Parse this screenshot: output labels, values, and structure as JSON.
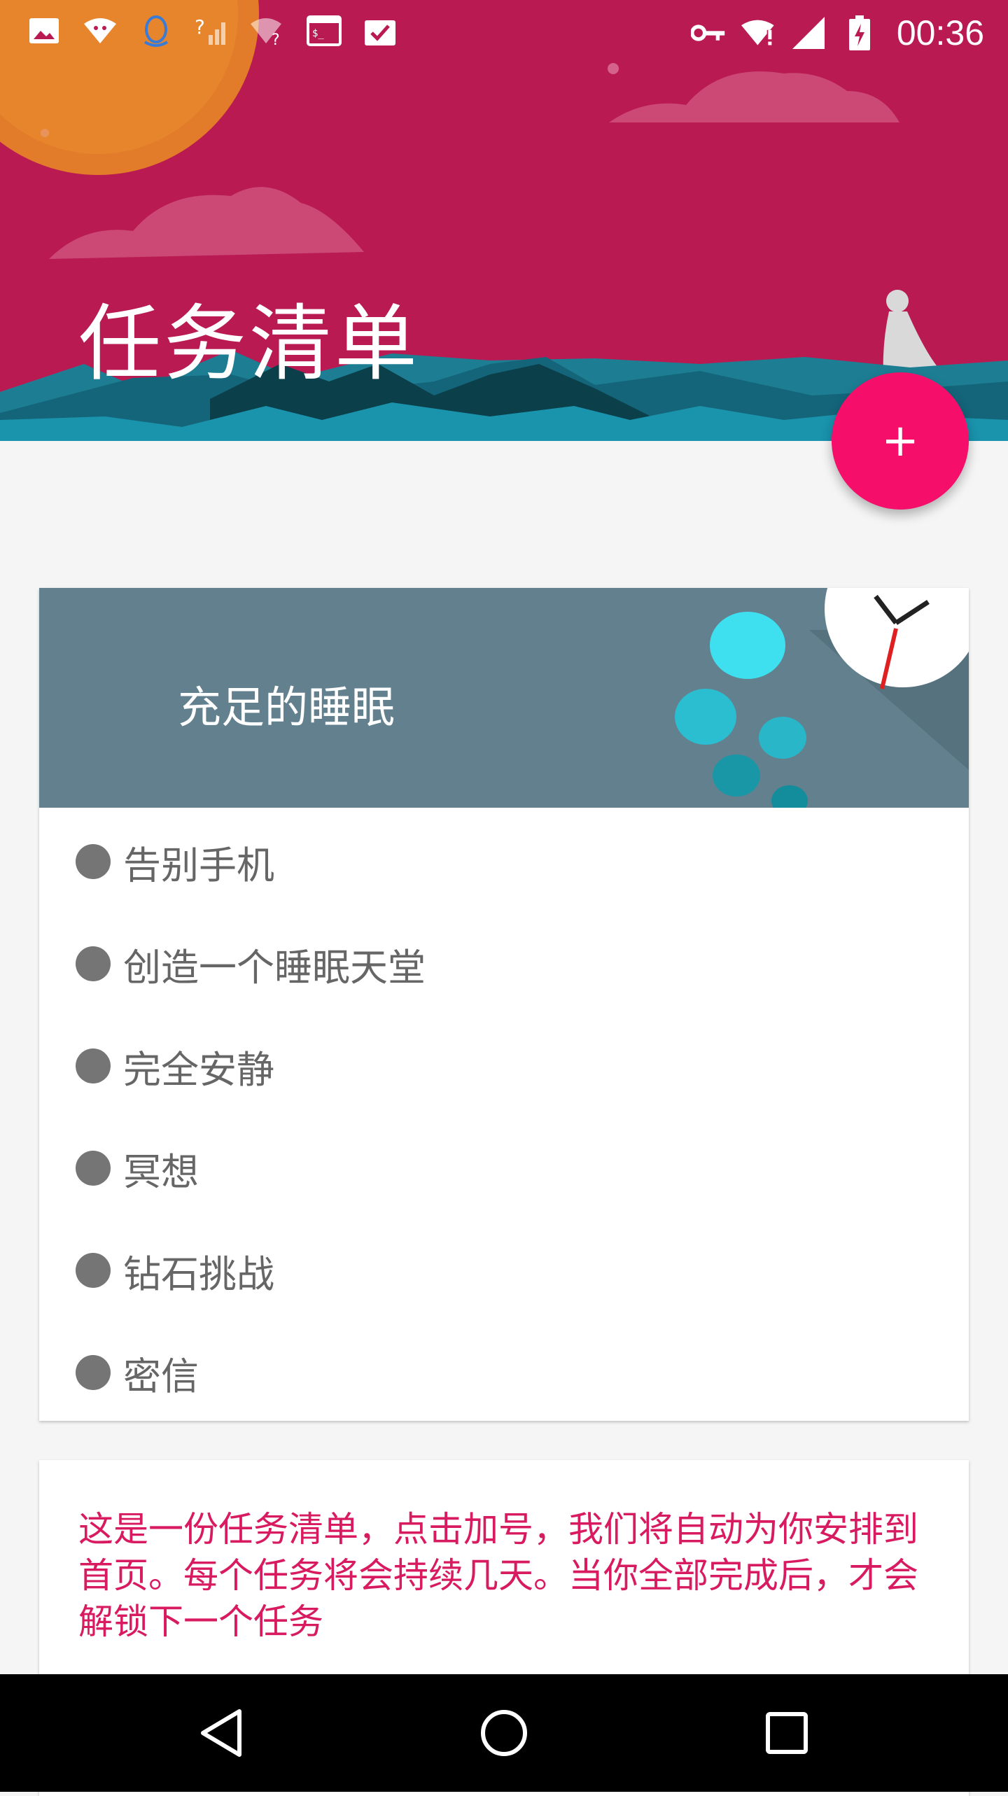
{
  "status_bar": {
    "time": "00:36",
    "left_icons": [
      "image-icon",
      "wifi-icon",
      "android-icon",
      "qq-icon",
      "signal-unknown-icon",
      "wifi-unknown-icon",
      "terminal-icon",
      "clipboard-check-icon"
    ],
    "right_icons": [
      "key-icon",
      "wifi-alert-icon",
      "signal-icon",
      "battery-charging-icon"
    ]
  },
  "header": {
    "title": "任务清单",
    "background_color": "#b91a52"
  },
  "fab": {
    "label": "+",
    "color": "#f50f6a"
  },
  "task_card": {
    "title": "充足的睡眠",
    "banner_color": "#62808e",
    "tasks": [
      {
        "label": "告别手机"
      },
      {
        "label": "创造一个睡眠天堂"
      },
      {
        "label": "完全安静"
      },
      {
        "label": "冥想"
      },
      {
        "label": "钻石挑战"
      },
      {
        "label": "密信"
      }
    ]
  },
  "info_card": {
    "text": "这是一份任务清单，点击加号，我们将自动为你安排到首页。每个任务将会持续几天。当你全部完成后，才会解锁下一个任务",
    "text_color": "#d81b60"
  },
  "nav_bar": {
    "buttons": [
      "back-icon",
      "home-icon",
      "recents-icon"
    ]
  }
}
